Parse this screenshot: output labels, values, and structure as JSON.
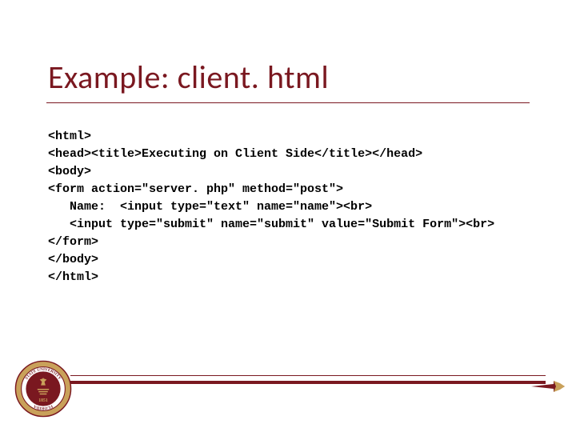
{
  "title": "Example: client. html",
  "code_lines": [
    "<html>",
    "<head><title>Executing on Client Side</title></head>",
    "<body>",
    "<form action=\"server. php\" method=\"post\">",
    "   Name:  <input type=\"text\" name=\"name\"><br>",
    "   <input type=\"submit\" name=\"submit\" value=\"Submit Form\"><br>",
    "</form>",
    "</body>",
    "</html>"
  ],
  "seal_text_top": "STATE UNIVERSITY",
  "seal_text_side": "FLORIDA",
  "seal_year": "1851",
  "icons": {
    "seal": "university-seal-icon",
    "spear": "spear-icon"
  }
}
